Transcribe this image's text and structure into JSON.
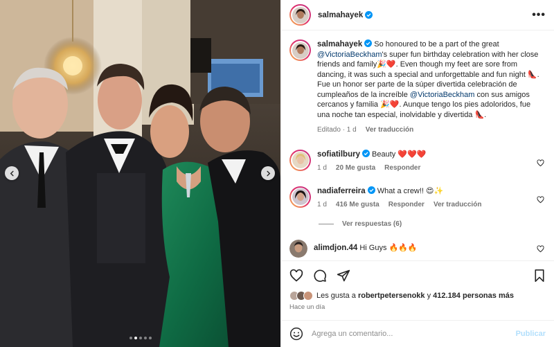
{
  "post": {
    "author": "salmahayek",
    "more_label": "•••",
    "caption": {
      "part1": "So honoured to be a part of the great",
      "mention1": "@VictoriaBeckham",
      "part2": "'s super fun birthday celebration with her close friends and family🎉❤️. Even though my feet are sore from dancing, it was such a special and unforgettable and fun night 👠.",
      "part3": "Fue un honor ser parte de la súper divertida celebración de cumpleaños de la increíble",
      "mention2": "@VictoriaBeckham",
      "part4": "con sus amigos cercanos y familia 🎉❤️. Aunque tengo los pies adoloridos, fue una noche tan especial, inolvidable y divertida 👠.",
      "edited": "Editado · 1 d",
      "translate": "Ver traducción"
    }
  },
  "comments": [
    {
      "user": "sofiatilbury",
      "text": "Beauty ❤️❤️❤️",
      "time": "1 d",
      "likes": "20 Me gusta",
      "reply": "Responder",
      "translate": ""
    },
    {
      "user": "nadiaferreira",
      "text": "What a crew!! 😍✨",
      "time": "1 d",
      "likes": "416 Me gusta",
      "reply": "Responder",
      "translate": "Ver traducción"
    },
    {
      "user": "alimdjon.44",
      "text": "Hi Guys 🔥🔥🔥"
    }
  ],
  "view_replies": "Ver respuestas (6)",
  "likes_line": {
    "prefix": "Les gusta a",
    "user": "robertpetersenokk",
    "middle": "y",
    "count": "412.184 personas más"
  },
  "posted": "Hace un día",
  "composer": {
    "placeholder": "Agrega un comentario...",
    "publish": "Publicar"
  },
  "carousel": {
    "slides": 5,
    "active_index": 1
  },
  "colors": {
    "accent": "#0095f6",
    "link": "#00376b",
    "verified": "#0095f6",
    "publish_disabled": "#b2dffc"
  },
  "icons": [
    "chevron-left-icon",
    "chevron-right-icon",
    "heart-icon",
    "comment-icon",
    "share-icon",
    "bookmark-icon",
    "emoji-icon",
    "verified-icon"
  ]
}
